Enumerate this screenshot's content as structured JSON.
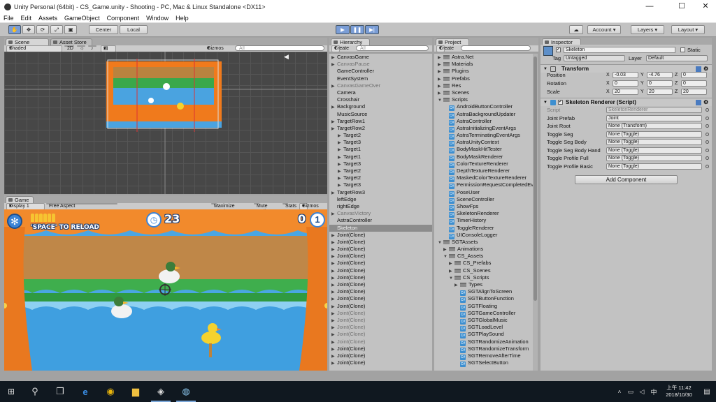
{
  "window": {
    "title": "Unity Personal (64bit) - CS_Game.unity - Shooting - PC, Mac & Linux Standalone <DX11>",
    "minimize": "—",
    "maximize": "☐",
    "close": "✕"
  },
  "menu": [
    "File",
    "Edit",
    "Assets",
    "GameObject",
    "Component",
    "Window",
    "Help"
  ],
  "toolbar": {
    "pivot": "Center",
    "space": "Local",
    "account": "Account",
    "layers": "Layers",
    "layout": "Layout"
  },
  "scene": {
    "tab": "Scene",
    "tab2": "Asset Store",
    "shading": "Shaded",
    "mode2d": "2D",
    "gizmos": "Gizmos",
    "search": "All"
  },
  "game": {
    "tab": "Game",
    "display": "Display 1",
    "aspect": "Free Aspect",
    "max_play": "Maximize on Play",
    "mute": "Mute audio",
    "stats": "Stats",
    "gizmos": "Gizmos",
    "reload": "'SPACE' TO RELOAD",
    "timer": "23",
    "score_left": "0",
    "score_right": "1"
  },
  "hierarchy": {
    "tab": "Hierarchy",
    "create": "Create",
    "search": "All",
    "rows": [
      {
        "label": "CanvasGame",
        "arrow": true,
        "depth": 0,
        "dim": false
      },
      {
        "label": "CanvasPause",
        "arrow": true,
        "depth": 0,
        "dim": true
      },
      {
        "label": "GameController",
        "arrow": false,
        "depth": 0,
        "dim": false
      },
      {
        "label": "EventSystem",
        "arrow": false,
        "depth": 0,
        "dim": false
      },
      {
        "label": "CanvasGameOver",
        "arrow": true,
        "depth": 0,
        "dim": true
      },
      {
        "label": "Camera",
        "arrow": false,
        "depth": 0,
        "dim": false
      },
      {
        "label": "Crosshair",
        "arrow": false,
        "depth": 0,
        "dim": false
      },
      {
        "label": "Background",
        "arrow": true,
        "depth": 0,
        "dim": false
      },
      {
        "label": "MusicSource",
        "arrow": false,
        "depth": 0,
        "dim": false
      },
      {
        "label": "TargetRow1",
        "arrow": true,
        "depth": 0,
        "dim": false
      },
      {
        "label": "TargetRow2",
        "arrow": true,
        "depth": 0,
        "dim": false
      },
      {
        "label": "Target2",
        "arrow": true,
        "depth": 1,
        "dim": false
      },
      {
        "label": "Target3",
        "arrow": true,
        "depth": 1,
        "dim": false
      },
      {
        "label": "Target1",
        "arrow": true,
        "depth": 1,
        "dim": false
      },
      {
        "label": "Target1",
        "arrow": true,
        "depth": 1,
        "dim": false
      },
      {
        "label": "Target3",
        "arrow": true,
        "depth": 1,
        "dim": false
      },
      {
        "label": "Target2",
        "arrow": true,
        "depth": 1,
        "dim": false
      },
      {
        "label": "Target2",
        "arrow": true,
        "depth": 1,
        "dim": false
      },
      {
        "label": "Target3",
        "arrow": true,
        "depth": 1,
        "dim": false
      },
      {
        "label": "TargetRow3",
        "arrow": true,
        "depth": 0,
        "dim": false
      },
      {
        "label": "leftEdge",
        "arrow": false,
        "depth": 0,
        "dim": false
      },
      {
        "label": "rightEdge",
        "arrow": false,
        "depth": 0,
        "dim": false
      },
      {
        "label": "CanvasVictory",
        "arrow": true,
        "depth": 0,
        "dim": true
      },
      {
        "label": "AstraController",
        "arrow": false,
        "depth": 0,
        "dim": false
      },
      {
        "label": "Skeleton",
        "arrow": false,
        "depth": 0,
        "dim": false,
        "selected": true
      },
      {
        "label": "Joint(Clone)",
        "arrow": true,
        "depth": 0,
        "dim": false
      },
      {
        "label": "Joint(Clone)",
        "arrow": true,
        "depth": 0,
        "dim": false
      },
      {
        "label": "Joint(Clone)",
        "arrow": true,
        "depth": 0,
        "dim": false
      },
      {
        "label": "Joint(Clone)",
        "arrow": true,
        "depth": 0,
        "dim": false
      },
      {
        "label": "Joint(Clone)",
        "arrow": true,
        "depth": 0,
        "dim": false
      },
      {
        "label": "Joint(Clone)",
        "arrow": true,
        "depth": 0,
        "dim": false
      },
      {
        "label": "Joint(Clone)",
        "arrow": true,
        "depth": 0,
        "dim": false
      },
      {
        "label": "Joint(Clone)",
        "arrow": true,
        "depth": 0,
        "dim": false
      },
      {
        "label": "Joint(Clone)",
        "arrow": true,
        "depth": 0,
        "dim": false
      },
      {
        "label": "Joint(Clone)",
        "arrow": true,
        "depth": 0,
        "dim": false
      },
      {
        "label": "Joint(Clone)",
        "arrow": true,
        "depth": 0,
        "dim": false
      },
      {
        "label": "Joint(Clone)",
        "arrow": true,
        "depth": 0,
        "dim": true
      },
      {
        "label": "Joint(Clone)",
        "arrow": true,
        "depth": 0,
        "dim": true
      },
      {
        "label": "Joint(Clone)",
        "arrow": true,
        "depth": 0,
        "dim": true
      },
      {
        "label": "Joint(Clone)",
        "arrow": true,
        "depth": 0,
        "dim": true
      },
      {
        "label": "Joint(Clone)",
        "arrow": true,
        "depth": 0,
        "dim": true
      },
      {
        "label": "Joint(Clone)",
        "arrow": true,
        "depth": 0,
        "dim": false
      },
      {
        "label": "Joint(Clone)",
        "arrow": true,
        "depth": 0,
        "dim": false
      },
      {
        "label": "Joint(Clone)",
        "arrow": true,
        "depth": 0,
        "dim": false
      }
    ]
  },
  "project": {
    "tab": "Project",
    "create": "Create",
    "rows": [
      {
        "label": "Astra.Net",
        "kind": "folder",
        "depth": 0,
        "arrow": true
      },
      {
        "label": "Materials",
        "kind": "folder",
        "depth": 0,
        "arrow": true
      },
      {
        "label": "Plugins",
        "kind": "folder",
        "depth": 0,
        "arrow": true
      },
      {
        "label": "Prefabs",
        "kind": "folder",
        "depth": 0,
        "arrow": true
      },
      {
        "label": "Res",
        "kind": "folder",
        "depth": 0,
        "arrow": true
      },
      {
        "label": "Scenes",
        "kind": "folder",
        "depth": 0,
        "arrow": true
      },
      {
        "label": "Scripts",
        "kind": "folder",
        "depth": 0,
        "arrow": true
      },
      {
        "label": "AndroidButtonController",
        "kind": "script",
        "depth": 1
      },
      {
        "label": "AstraBackgroundUpdater",
        "kind": "script",
        "depth": 1
      },
      {
        "label": "AstraController",
        "kind": "script",
        "depth": 1
      },
      {
        "label": "AstraInitializingEventArgs",
        "kind": "script",
        "depth": 1
      },
      {
        "label": "AstraTerminatingEventArgs",
        "kind": "script",
        "depth": 1
      },
      {
        "label": "AstraUnityContext",
        "kind": "script",
        "depth": 1
      },
      {
        "label": "BodyMaskHitTester",
        "kind": "script",
        "depth": 1
      },
      {
        "label": "BodyMaskRenderer",
        "kind": "script",
        "depth": 1
      },
      {
        "label": "ColorTextureRenderer",
        "kind": "script",
        "depth": 1
      },
      {
        "label": "DepthTextureRenderer",
        "kind": "script",
        "depth": 1
      },
      {
        "label": "MaskedColorTextureRenderer",
        "kind": "script",
        "depth": 1
      },
      {
        "label": "PermissionRequestCompletedEv",
        "kind": "script",
        "depth": 1
      },
      {
        "label": "PoseUser",
        "kind": "script",
        "depth": 1
      },
      {
        "label": "SceneController",
        "kind": "script",
        "depth": 1
      },
      {
        "label": "ShowFps",
        "kind": "script",
        "depth": 1
      },
      {
        "label": "SkeletonRenderer",
        "kind": "script",
        "depth": 1
      },
      {
        "label": "TimerHistory",
        "kind": "script",
        "depth": 1
      },
      {
        "label": "ToggleRenderer",
        "kind": "script",
        "depth": 1
      },
      {
        "label": "UIConsoleLogger",
        "kind": "script",
        "depth": 1
      },
      {
        "label": "SGTAssets",
        "kind": "folder",
        "depth": 0,
        "arrow": true
      },
      {
        "label": "Animations",
        "kind": "folder",
        "depth": 1,
        "arrow": true
      },
      {
        "label": "CS_Assets",
        "kind": "folder",
        "depth": 1,
        "arrow": true
      },
      {
        "label": "CS_Prefabs",
        "kind": "folder",
        "depth": 2,
        "arrow": true
      },
      {
        "label": "CS_Scenes",
        "kind": "folder",
        "depth": 2,
        "arrow": true
      },
      {
        "label": "CS_Scripts",
        "kind": "folder",
        "depth": 2,
        "arrow": true
      },
      {
        "label": "Types",
        "kind": "folder",
        "depth": 3,
        "arrow": true
      },
      {
        "label": "SGTAlignToScreen",
        "kind": "script",
        "depth": 3
      },
      {
        "label": "SGTButtonFunction",
        "kind": "script",
        "depth": 3
      },
      {
        "label": "SGTFloating",
        "kind": "script",
        "depth": 3
      },
      {
        "label": "SGTGameController",
        "kind": "script",
        "depth": 3
      },
      {
        "label": "SGTGlobalMusic",
        "kind": "script",
        "depth": 3
      },
      {
        "label": "SGTLoadLevel",
        "kind": "script",
        "depth": 3
      },
      {
        "label": "SGTPlaySound",
        "kind": "script",
        "depth": 3
      },
      {
        "label": "SGTRandomizeAnimation",
        "kind": "script",
        "depth": 3
      },
      {
        "label": "SGTRandomizeTransform",
        "kind": "script",
        "depth": 3
      },
      {
        "label": "SGTRemoveAfterTime",
        "kind": "script",
        "depth": 3
      },
      {
        "label": "SGTSelectButton",
        "kind": "script",
        "depth": 3
      }
    ]
  },
  "inspector": {
    "tab": "Inspector",
    "object_name": "Skeleton",
    "static": "Static",
    "tag_label": "Tag",
    "tag": "Untagged",
    "layer_label": "Layer",
    "layer": "Default",
    "transform": {
      "title": "Transform",
      "position": {
        "label": "Position",
        "x": "-0.03",
        "y": "-4.76",
        "z": "0"
      },
      "rotation": {
        "label": "Rotation",
        "x": "0",
        "y": "0",
        "z": "0"
      },
      "scale": {
        "label": "Scale",
        "x": "20",
        "y": "20",
        "z": "20"
      }
    },
    "skeleton_renderer": {
      "title": "Skeleton Renderer (Script)",
      "fields": [
        {
          "label": "Script",
          "value": "SkeletonRenderer",
          "dim": true
        },
        {
          "label": "Joint Prefab",
          "value": "Joint"
        },
        {
          "label": "Joint Root",
          "value": "None (Transform)"
        },
        {
          "label": "Toggle Seg",
          "value": "None (Toggle)"
        },
        {
          "label": "Toggle Seg Body",
          "value": "None (Toggle)"
        },
        {
          "label": "Toggle Seg Body Hand",
          "value": "None (Toggle)"
        },
        {
          "label": "Toggle Profile Full",
          "value": "None (Toggle)"
        },
        {
          "label": "Toggle Profile Basic",
          "value": "None (Toggle)"
        }
      ]
    },
    "add_component": "Add Component"
  },
  "taskbar": {
    "time": "上午 11:42",
    "date": "2018/10/30"
  }
}
